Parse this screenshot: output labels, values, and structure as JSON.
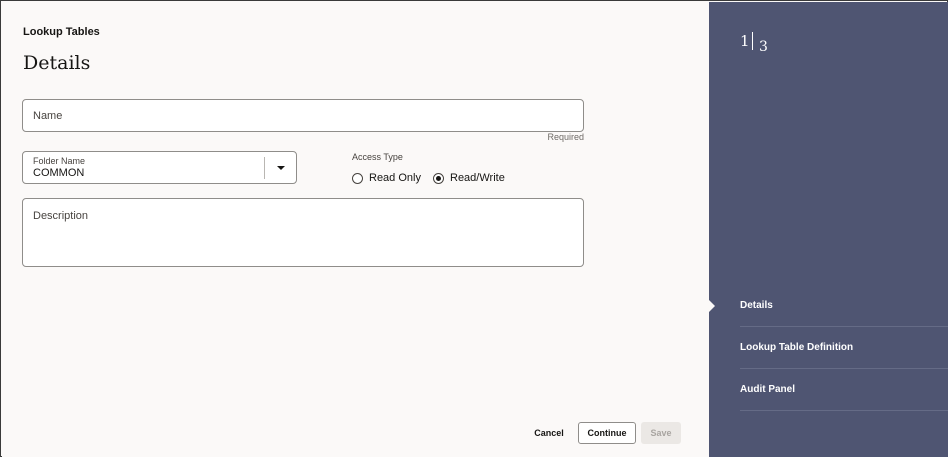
{
  "header": {
    "app_title": "Lookup Tables",
    "page_title": "Details"
  },
  "form": {
    "name": {
      "label": "Name",
      "value": "",
      "hint": "Required"
    },
    "folder": {
      "label": "Folder Name",
      "value": "COMMON"
    },
    "access_type": {
      "label": "Access Type",
      "options": [
        {
          "label": "Read Only",
          "selected": false
        },
        {
          "label": "Read/Write",
          "selected": true
        }
      ]
    },
    "description": {
      "label": "Description",
      "value": ""
    }
  },
  "footer": {
    "cancel_label": "Cancel",
    "continue_label": "Continue",
    "save_label": "Save"
  },
  "train": {
    "current_step": "1",
    "total_steps": "3",
    "steps": [
      {
        "label": "Details",
        "active": true
      },
      {
        "label": "Lookup Table Definition",
        "active": false
      },
      {
        "label": "Audit Panel",
        "active": false
      }
    ]
  },
  "colors": {
    "page_bg": "#fbf9f8",
    "train_bg": "#4f5572",
    "text": "#161513",
    "border": "#8f8d8a"
  }
}
